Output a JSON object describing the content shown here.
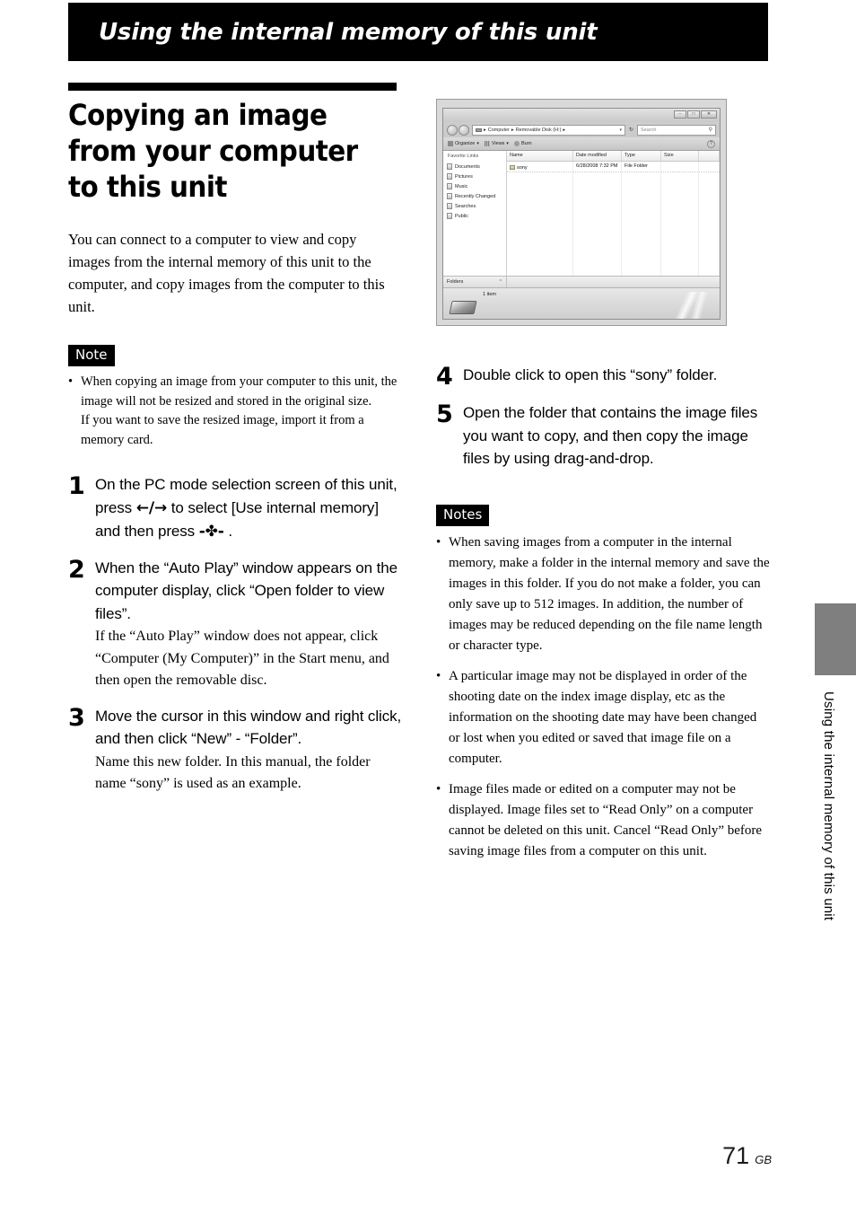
{
  "banner": {
    "title": "Using the internal memory of this unit"
  },
  "section": {
    "title": "Copying an image from your computer to this unit",
    "intro": "You can connect to a computer to view and copy images from the internal memory of this unit to the computer, and copy images from the computer to this unit."
  },
  "note_left": {
    "label": "Note",
    "items": [
      "When copying an image from your computer to this unit, the image will not be resized and stored in the original size.\nIf you want to save the resized image, import it from a memory card."
    ]
  },
  "steps": [
    {
      "num": "1",
      "main_pre": "On the PC mode selection screen of this unit, press ",
      "glyph1": "←/→",
      "main_mid": " to select [Use internal memory] and then press ",
      "glyph2": "-✤-",
      "main_post": " .",
      "sub": ""
    },
    {
      "num": "2",
      "main": "When the “Auto Play” window appears on the computer display, click “Open folder to view files”.",
      "sub": "If the “Auto Play” window does not appear, click “Computer (My Computer)” in the Start menu, and then open the removable disc."
    },
    {
      "num": "3",
      "main": "Move the cursor in this window and right click, and then click “New” - “Folder”.",
      "sub": "Name this new folder. In this manual, the folder name “sony” is used as an example."
    },
    {
      "num": "4",
      "main": "Double click to open this “sony” folder.",
      "sub": ""
    },
    {
      "num": "5",
      "main": "Open the folder that contains the image files you want to copy, and then copy the image files by using drag-and-drop.",
      "sub": ""
    }
  ],
  "screenshot": {
    "window_buttons": {
      "minimize": "–",
      "maximize": "□",
      "close": "✕"
    },
    "address": {
      "computer": "Computer",
      "separator": "▸",
      "drive": "Removable Disk (H:)",
      "trailing": "▸",
      "caret": "▾",
      "refresh": "↻"
    },
    "search": {
      "placeholder": "Search",
      "icon": "⚲"
    },
    "toolbar": {
      "organize": "Organize",
      "views": "Views",
      "burn": "Burn",
      "caret": "▾",
      "help": "?"
    },
    "sidebar": {
      "title": "Favorite Links",
      "items": [
        "Documents",
        "Pictures",
        "Music",
        "Recently Changed",
        "Searches",
        "Public"
      ]
    },
    "columns": [
      "Name",
      "Date modified",
      "Type",
      "Size"
    ],
    "rows": [
      {
        "name": "sony",
        "date_modified": "6/28/2008 7:32 PM",
        "type": "File Folder",
        "size": ""
      }
    ],
    "folders_pane": {
      "label": "Folders",
      "chevron": "⌃"
    },
    "status": {
      "item_count": "1 item"
    }
  },
  "note_right": {
    "label": "Notes",
    "items": [
      "When saving images from a computer in the internal memory, make a folder in the internal memory and save the images in this folder. If you do not make a folder, you can only save up to 512 images. In addition, the number of images may be reduced depending on the file name length or character type.",
      "A particular image may not be displayed in order of the shooting date on the index image display, etc as the information on the shooting date may have been changed or lost when you edited or saved that image file on a computer.",
      "Image files made or edited on a computer may not be displayed. Image files set to “Read Only” on a computer cannot be deleted on this unit. Cancel “Read Only” before saving image files from a computer on this unit."
    ]
  },
  "side_tab": {
    "text": "Using the internal memory of this unit"
  },
  "footer": {
    "page_number": "71",
    "region": "GB"
  }
}
